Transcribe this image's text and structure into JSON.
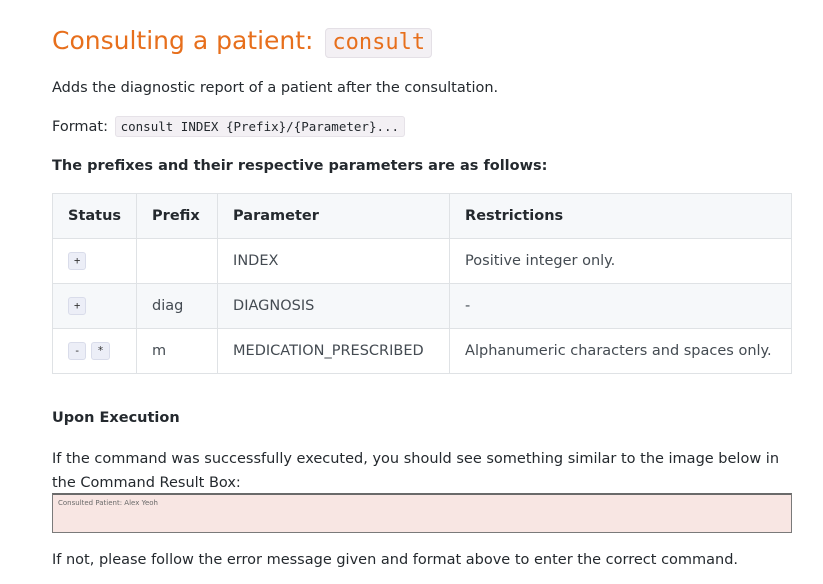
{
  "section": {
    "title_text": "Consulting a patient: ",
    "title_code": "consult",
    "description": "Adds the diagnostic report of a patient after the consultation.",
    "format_label": "Format:",
    "format_code": "consult INDEX {Prefix}/{Parameter}...",
    "prefixes_heading": "The prefixes and their respective parameters are as follows:"
  },
  "table": {
    "headers": [
      "Status",
      "Prefix",
      "Parameter",
      "Restrictions"
    ],
    "rows": [
      {
        "status": [
          "+"
        ],
        "prefix": "",
        "parameter": "INDEX",
        "restrictions": "Positive integer only."
      },
      {
        "status": [
          "+"
        ],
        "prefix": "diag",
        "parameter": "DIAGNOSIS",
        "restrictions": "-"
      },
      {
        "status": [
          "-",
          "*"
        ],
        "prefix": "m",
        "parameter": "MEDICATION_PRESCRIBED",
        "restrictions": "Alphanumeric characters and spaces only."
      }
    ]
  },
  "execution": {
    "heading": "Upon Execution",
    "success_text": "If the command was successfully executed, you should see something similar to the image below in the Command Result Box:",
    "result_box_text": "Consulted Patient: Alex Yeoh",
    "fail_text": "If not, please follow the error message given and format above to enter the correct command."
  },
  "colors": {
    "title": "#e76f1c",
    "result_box_bg": "#f8e6e3",
    "table_border": "#dfe2e5",
    "header_bg": "#f6f8fa"
  }
}
